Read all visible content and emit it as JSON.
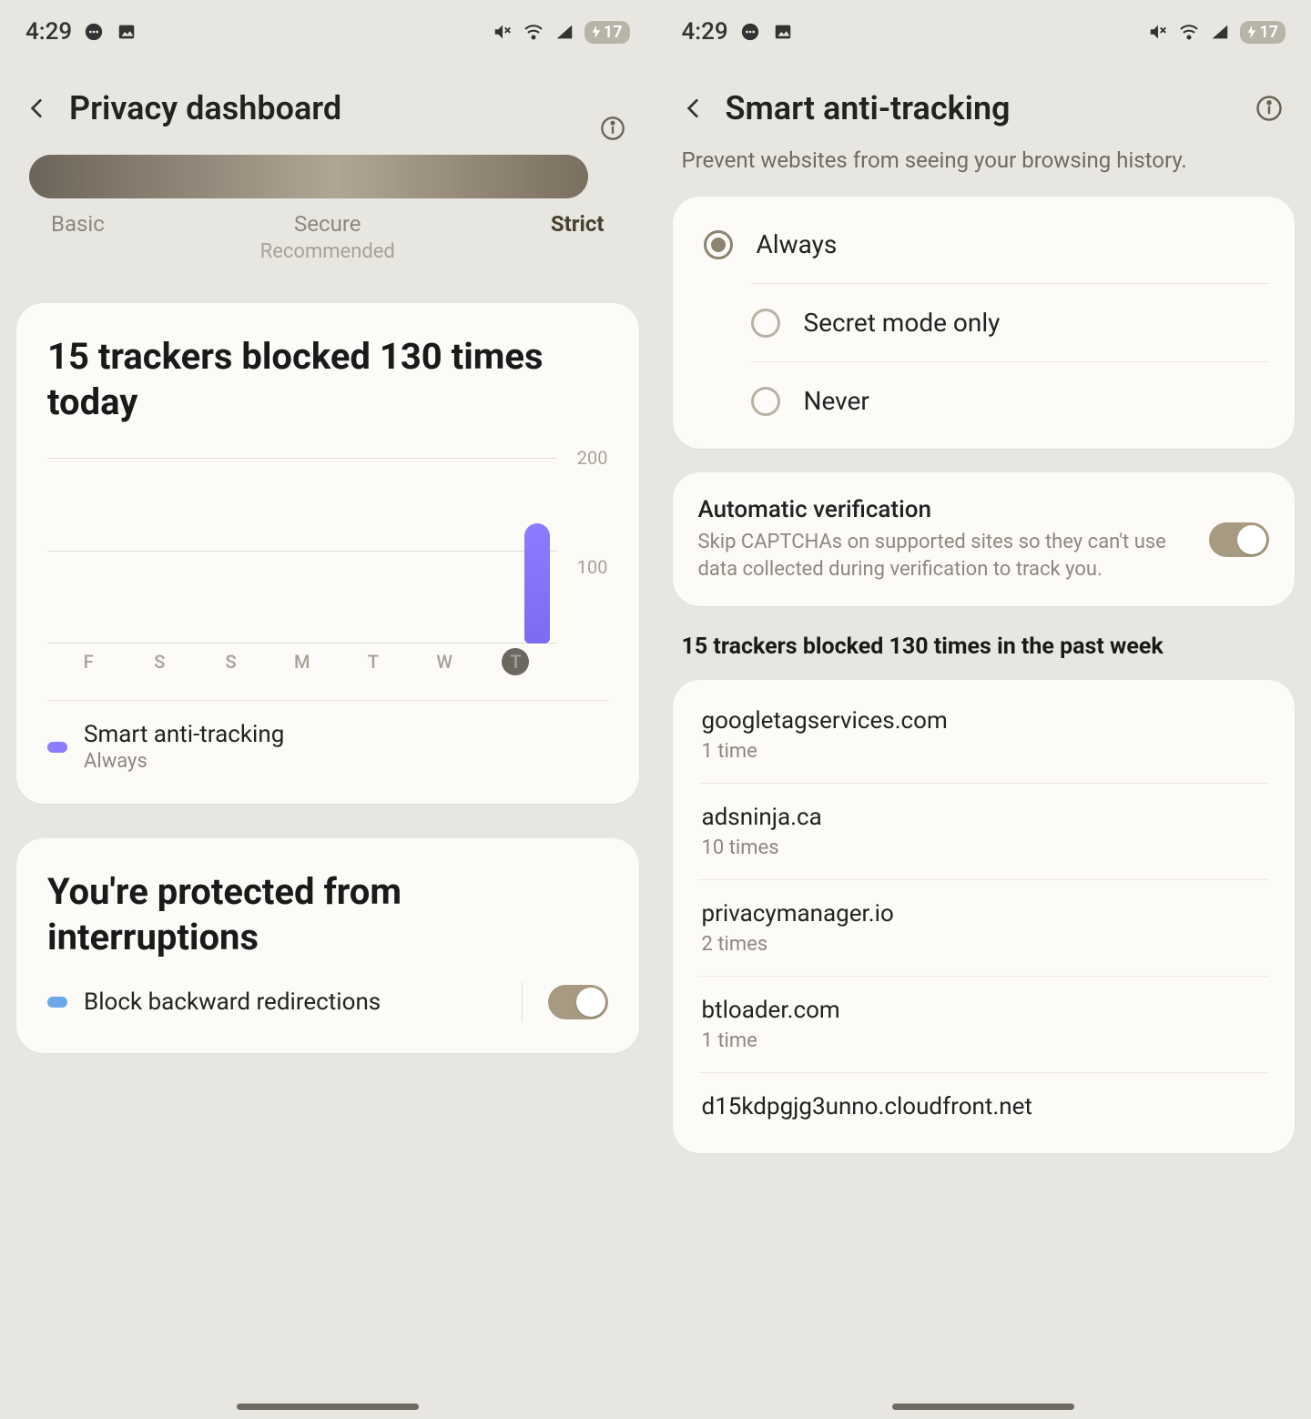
{
  "status": {
    "time": "4:29",
    "battery": "17"
  },
  "left": {
    "title": "Privacy dashboard",
    "levels": {
      "basic": "Basic",
      "secure": "Secure",
      "recommended": "Recommended",
      "strict": "Strict"
    },
    "trackers_heading": "15 trackers blocked 130 times today",
    "legend_title": "Smart anti-tracking",
    "legend_value": "Always",
    "protected_heading": "You're protected from interruptions",
    "block_backward_label": "Block backward redirections"
  },
  "right": {
    "title": "Smart anti-tracking",
    "subtitle": "Prevent websites from seeing your browsing history.",
    "options": {
      "always": "Always",
      "secret": "Secret mode only",
      "never": "Never"
    },
    "auto_verify": {
      "title": "Automatic verification",
      "desc": "Skip CAPTCHAs on supported sites so they can't use data collected during verification to track you."
    },
    "week_heading": "15 trackers blocked 130 times in the past week",
    "trackers": [
      {
        "name": "googletagservices.com",
        "count": "1 time"
      },
      {
        "name": "adsninja.ca",
        "count": "10 times"
      },
      {
        "name": "privacymanager.io",
        "count": "2 times"
      },
      {
        "name": "btloader.com",
        "count": "1 time"
      },
      {
        "name": "d15kdpgjg3unno.cloudfront.net",
        "count": ""
      }
    ]
  },
  "chart_data": {
    "type": "bar",
    "title": "Trackers blocked per day",
    "categories": [
      "F",
      "S",
      "S",
      "M",
      "T",
      "W",
      "T"
    ],
    "values": [
      0,
      0,
      0,
      0,
      0,
      0,
      130
    ],
    "ylim": [
      0,
      200
    ],
    "yticks": [
      100,
      200
    ],
    "highlight_index": 6,
    "series_name": "Smart anti-tracking"
  }
}
